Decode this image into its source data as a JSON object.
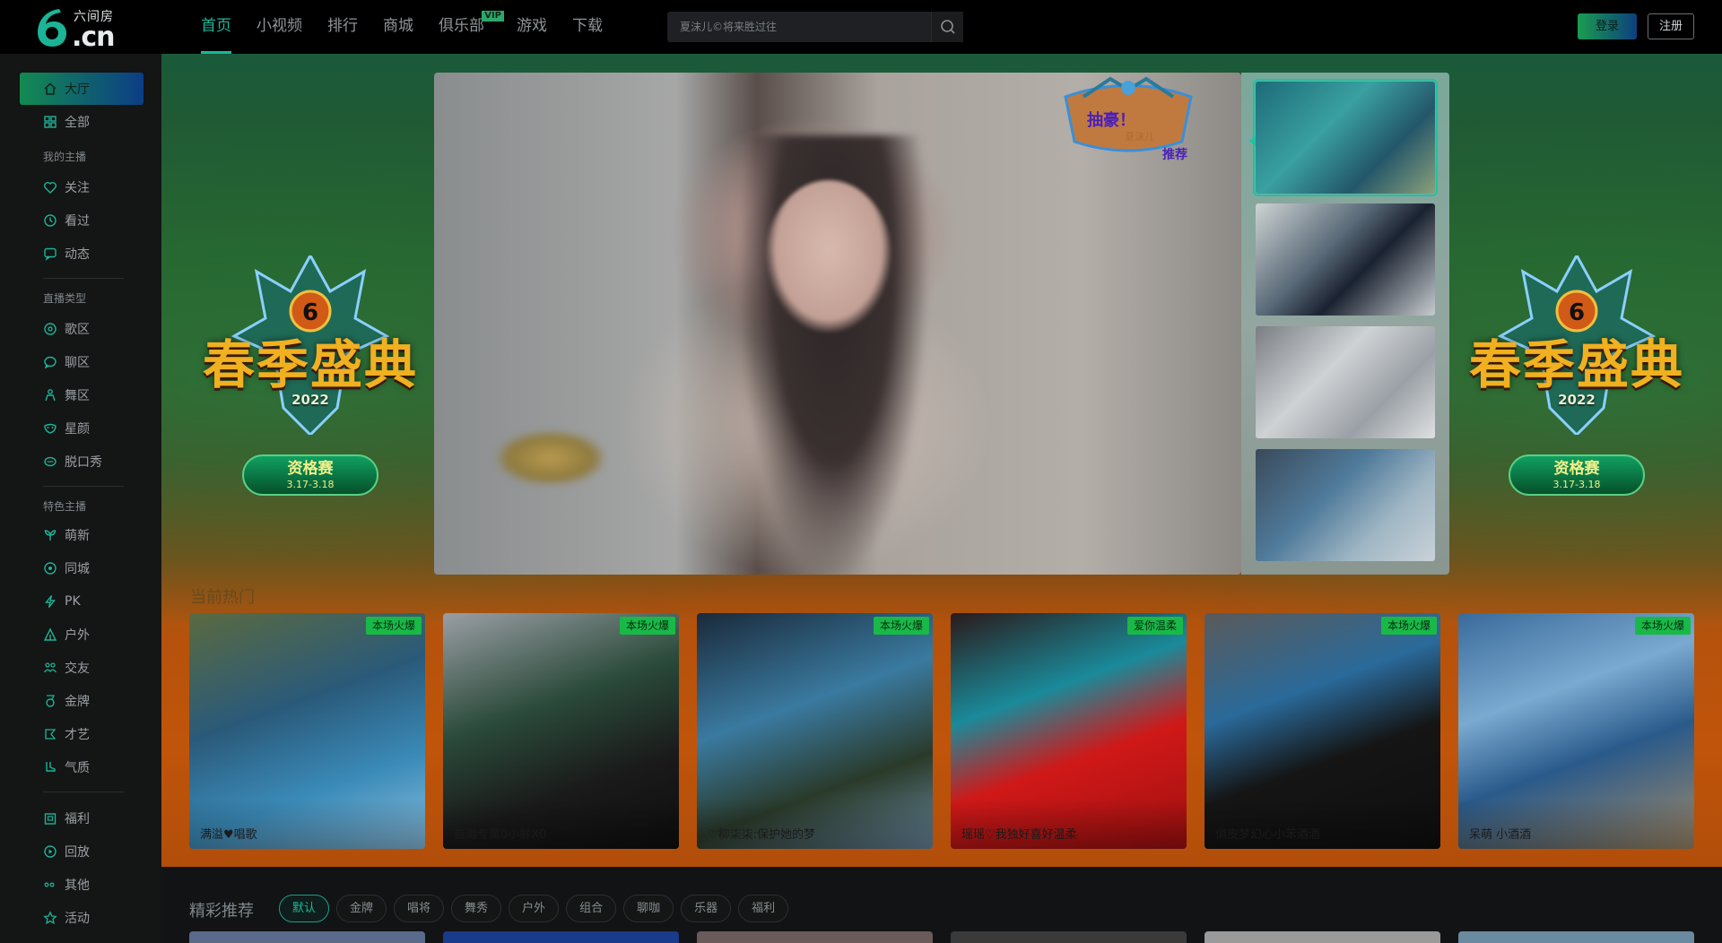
{
  "brand": {
    "name_cn": "六间房",
    "name_domain": ".cn"
  },
  "topnav": {
    "items": [
      "首页",
      "小视频",
      "排行",
      "商城",
      "俱乐部",
      "游戏",
      "下载"
    ],
    "vip_badge": "VIP"
  },
  "search": {
    "placeholder": "夏沫儿©将来胜过往"
  },
  "auth": {
    "login": "登录",
    "register": "注册"
  },
  "sidebar": {
    "top": [
      {
        "label": "大厅",
        "icon": "home-icon"
      },
      {
        "label": "全部",
        "icon": "grid-icon"
      }
    ],
    "groups": [
      {
        "title": "我的主播",
        "items": [
          {
            "label": "关注",
            "icon": "heart-icon"
          },
          {
            "label": "看过",
            "icon": "clock-icon"
          },
          {
            "label": "动态",
            "icon": "chat-icon"
          }
        ]
      },
      {
        "title": "直播类型",
        "items": [
          {
            "label": "歌区",
            "icon": "music-icon"
          },
          {
            "label": "聊区",
            "icon": "chat-bubble-icon"
          },
          {
            "label": "舞区",
            "icon": "dancer-icon"
          },
          {
            "label": "星颜",
            "icon": "mask-icon"
          },
          {
            "label": "脱口秀",
            "icon": "mouth-icon"
          }
        ]
      },
      {
        "title": "特色主播",
        "items": [
          {
            "label": "萌新",
            "icon": "sprout-icon"
          },
          {
            "label": "同城",
            "icon": "location-icon"
          },
          {
            "label": "PK",
            "icon": "bolt-icon"
          },
          {
            "label": "户外",
            "icon": "tent-icon"
          },
          {
            "label": "交友",
            "icon": "friends-icon"
          },
          {
            "label": "金牌",
            "icon": "medal-icon"
          },
          {
            "label": "才艺",
            "icon": "palette-icon"
          },
          {
            "label": "气质",
            "icon": "boot-icon"
          }
        ]
      },
      {
        "title": "",
        "items": [
          {
            "label": "福利",
            "icon": "gift-icon"
          },
          {
            "label": "回放",
            "icon": "replay-icon"
          },
          {
            "label": "其他",
            "icon": "dots-icon"
          },
          {
            "label": "活动",
            "icon": "star-icon"
          }
        ]
      }
    ]
  },
  "banner": {
    "title": "春季盛典",
    "year": "2022",
    "stage": "资格赛",
    "dates": "3.17-3.18"
  },
  "guard_badge": {
    "title": "抽豪！",
    "name": "夏沫儿",
    "action": "推荐"
  },
  "hot": {
    "title": "当前热门",
    "cards": [
      {
        "name": "满溢♥唱歌",
        "tag": "本场火爆"
      },
      {
        "name": "嘉瀚专属0小鲜X0",
        "tag": "本场火爆"
      },
      {
        "name": "♡柳柒柒:保护她的梦",
        "tag": "本场火爆"
      },
      {
        "name": "瑶瑶♡我独好喜好温柔",
        "tag": "爱你温柔"
      },
      {
        "name": "俏皮梦幻心小苯酒酒",
        "tag": "本场火爆"
      },
      {
        "name": "呆萌 小酒酒",
        "tag": "本场火爆"
      }
    ]
  },
  "recommend": {
    "title": "精彩推荐",
    "filters": [
      "默认",
      "金牌",
      "唱将",
      "舞秀",
      "户外",
      "组合",
      "聊咖",
      "乐器",
      "福利"
    ],
    "active_filter": "默认"
  },
  "colors": {
    "accent": "#18b89c",
    "login_gradient_start": "#1b9c50",
    "login_gradient_end": "#0d3f7e",
    "tag_green": "#19b948",
    "banner_orange": "#c0540a"
  }
}
